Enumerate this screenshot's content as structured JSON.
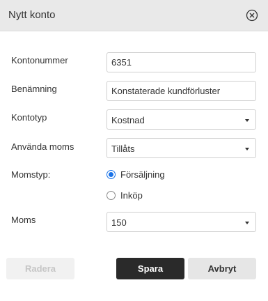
{
  "dialog": {
    "title": "Nytt konto",
    "close_icon": "close-circle-icon"
  },
  "form": {
    "account_number": {
      "label": "Kontonummer",
      "value": "6351"
    },
    "name": {
      "label": "Benämning",
      "value": "Konstaterade kundförluster"
    },
    "account_type": {
      "label": "Kontotyp",
      "value": "Kostnad"
    },
    "use_vat": {
      "label": "Använda moms",
      "value": "Tillåts"
    },
    "vat_type": {
      "label": "Momstyp:",
      "options": [
        {
          "label": "Försäljning",
          "checked": true
        },
        {
          "label": "Inköp",
          "checked": false
        }
      ]
    },
    "vat": {
      "label": "Moms",
      "value": "150"
    }
  },
  "buttons": {
    "delete": "Radera",
    "save": "Spara",
    "cancel": "Avbryt"
  },
  "colors": {
    "header_bg": "#e9e9e9",
    "radio_accent": "#1a73e8",
    "save_bg": "#2a2a2a",
    "delete_text_disabled": "#c6c6c6"
  }
}
